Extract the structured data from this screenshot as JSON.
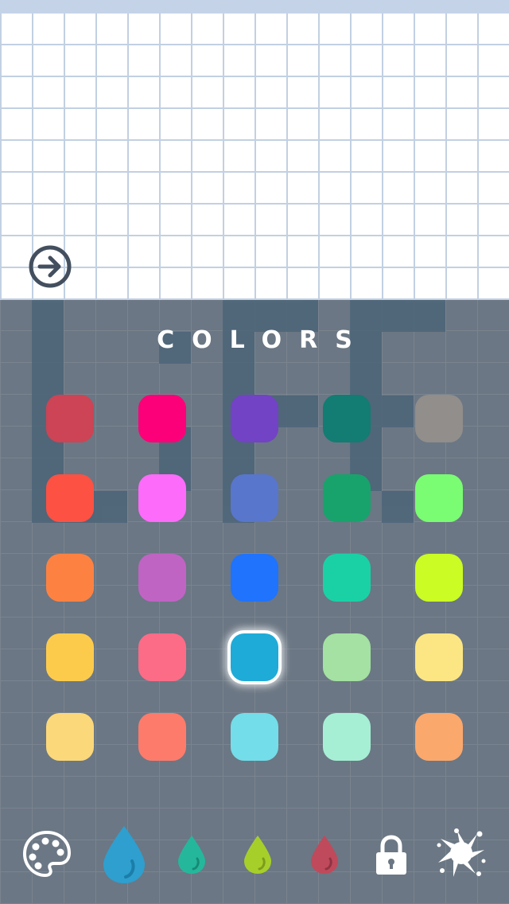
{
  "panel": {
    "title": "COLORS"
  },
  "swatches": [
    {
      "name": "swatch-crimson",
      "color": "#cc4455",
      "selected": false
    },
    {
      "name": "swatch-magenta",
      "color": "#fc0079",
      "selected": false
    },
    {
      "name": "swatch-purple",
      "color": "#7243c4",
      "selected": false
    },
    {
      "name": "swatch-dark-teal",
      "color": "#137c73",
      "selected": false
    },
    {
      "name": "swatch-gray",
      "color": "#918e8b",
      "selected": false
    },
    {
      "name": "swatch-red-orange",
      "color": "#fd5143",
      "selected": false
    },
    {
      "name": "swatch-pink-violet",
      "color": "#fd6bfa",
      "selected": false
    },
    {
      "name": "swatch-periwinkle",
      "color": "#5876cc",
      "selected": false
    },
    {
      "name": "swatch-green",
      "color": "#18a36c",
      "selected": false
    },
    {
      "name": "swatch-light-green",
      "color": "#7afc73",
      "selected": false
    },
    {
      "name": "swatch-orange",
      "color": "#fd8242",
      "selected": false
    },
    {
      "name": "swatch-orchid",
      "color": "#c064c4",
      "selected": false
    },
    {
      "name": "swatch-blue",
      "color": "#1f73fc",
      "selected": false
    },
    {
      "name": "swatch-turquoise",
      "color": "#1ad1a6",
      "selected": false
    },
    {
      "name": "swatch-lime",
      "color": "#cbfc23",
      "selected": false
    },
    {
      "name": "swatch-yellow",
      "color": "#fdcb4c",
      "selected": false
    },
    {
      "name": "swatch-rose",
      "color": "#fc6c87",
      "selected": false
    },
    {
      "name": "swatch-sky-blue",
      "color": "#1fabd8",
      "selected": true
    },
    {
      "name": "swatch-pale-green",
      "color": "#a4e1a2",
      "selected": false
    },
    {
      "name": "swatch-pale-yellow",
      "color": "#fbe683",
      "selected": false
    },
    {
      "name": "swatch-sand",
      "color": "#fbd87a",
      "selected": false
    },
    {
      "name": "swatch-salmon",
      "color": "#fd7b6b",
      "selected": false
    },
    {
      "name": "swatch-light-cyan",
      "color": "#73dde9",
      "selected": false
    },
    {
      "name": "swatch-mint",
      "color": "#a6efd5",
      "selected": false
    },
    {
      "name": "swatch-peach",
      "color": "#fba86d",
      "selected": false
    }
  ],
  "toolbar": [
    {
      "name": "palette-icon",
      "color": "#ffffff"
    },
    {
      "name": "blue-drop-icon",
      "color": "#2e9fcf"
    },
    {
      "name": "teal-drop-icon",
      "color": "#25b79c"
    },
    {
      "name": "lime-drop-icon",
      "color": "#a7cf2a"
    },
    {
      "name": "red-drop-icon",
      "color": "#bf4a5b"
    },
    {
      "name": "lock-icon",
      "color": "#ffffff"
    },
    {
      "name": "splat-icon",
      "color": "#ffffff"
    }
  ],
  "colors": {
    "canvas_bg": "#ffffff",
    "canvas_grid": "#c2d0e2",
    "panel_bg": "#6b7784",
    "panel_deco": "#4c6478",
    "top_bar": "#c5d3e8"
  }
}
